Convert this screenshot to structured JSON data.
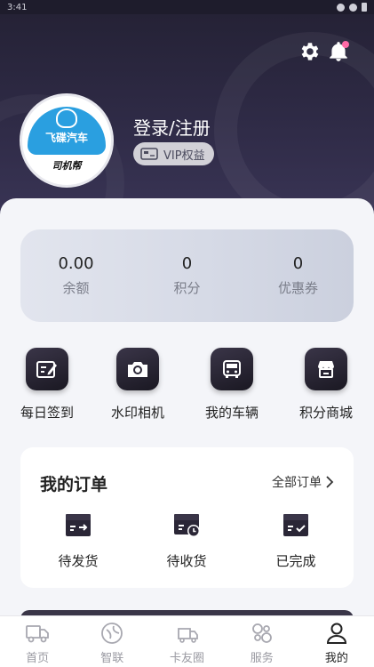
{
  "status_bar": {
    "time": "3:41"
  },
  "header": {
    "login_text": "登录/注册",
    "vip_label": "VIP权益",
    "avatar_brand": "飞碟汽车",
    "avatar_sub": "司机帮"
  },
  "stats": [
    {
      "value": "0.00",
      "label": "余额"
    },
    {
      "value": "0",
      "label": "积分"
    },
    {
      "value": "0",
      "label": "优惠券"
    }
  ],
  "quick_actions": [
    {
      "label": "每日签到",
      "icon": "checkin-icon"
    },
    {
      "label": "水印相机",
      "icon": "camera-icon"
    },
    {
      "label": "我的车辆",
      "icon": "truck-icon"
    },
    {
      "label": "积分商城",
      "icon": "shop-icon"
    }
  ],
  "orders": {
    "title": "我的订单",
    "all_label": "全部订单",
    "items": [
      {
        "label": "待发货",
        "icon": "pending-shipment-icon"
      },
      {
        "label": "待收货",
        "icon": "pending-receipt-icon"
      },
      {
        "label": "已完成",
        "icon": "completed-icon"
      }
    ]
  },
  "tabs": [
    {
      "label": "首页",
      "icon": "home-truck-icon"
    },
    {
      "label": "智联",
      "icon": "smart-link-icon"
    },
    {
      "label": "卡友圈",
      "icon": "community-icon"
    },
    {
      "label": "服务",
      "icon": "service-icon"
    },
    {
      "label": "我的",
      "icon": "profile-icon"
    }
  ],
  "colors": {
    "header_dark": "#252236",
    "accent_pink": "#ff6aa6",
    "icon_dark": "#1a1822",
    "brand_blue": "#2a9fe0"
  }
}
